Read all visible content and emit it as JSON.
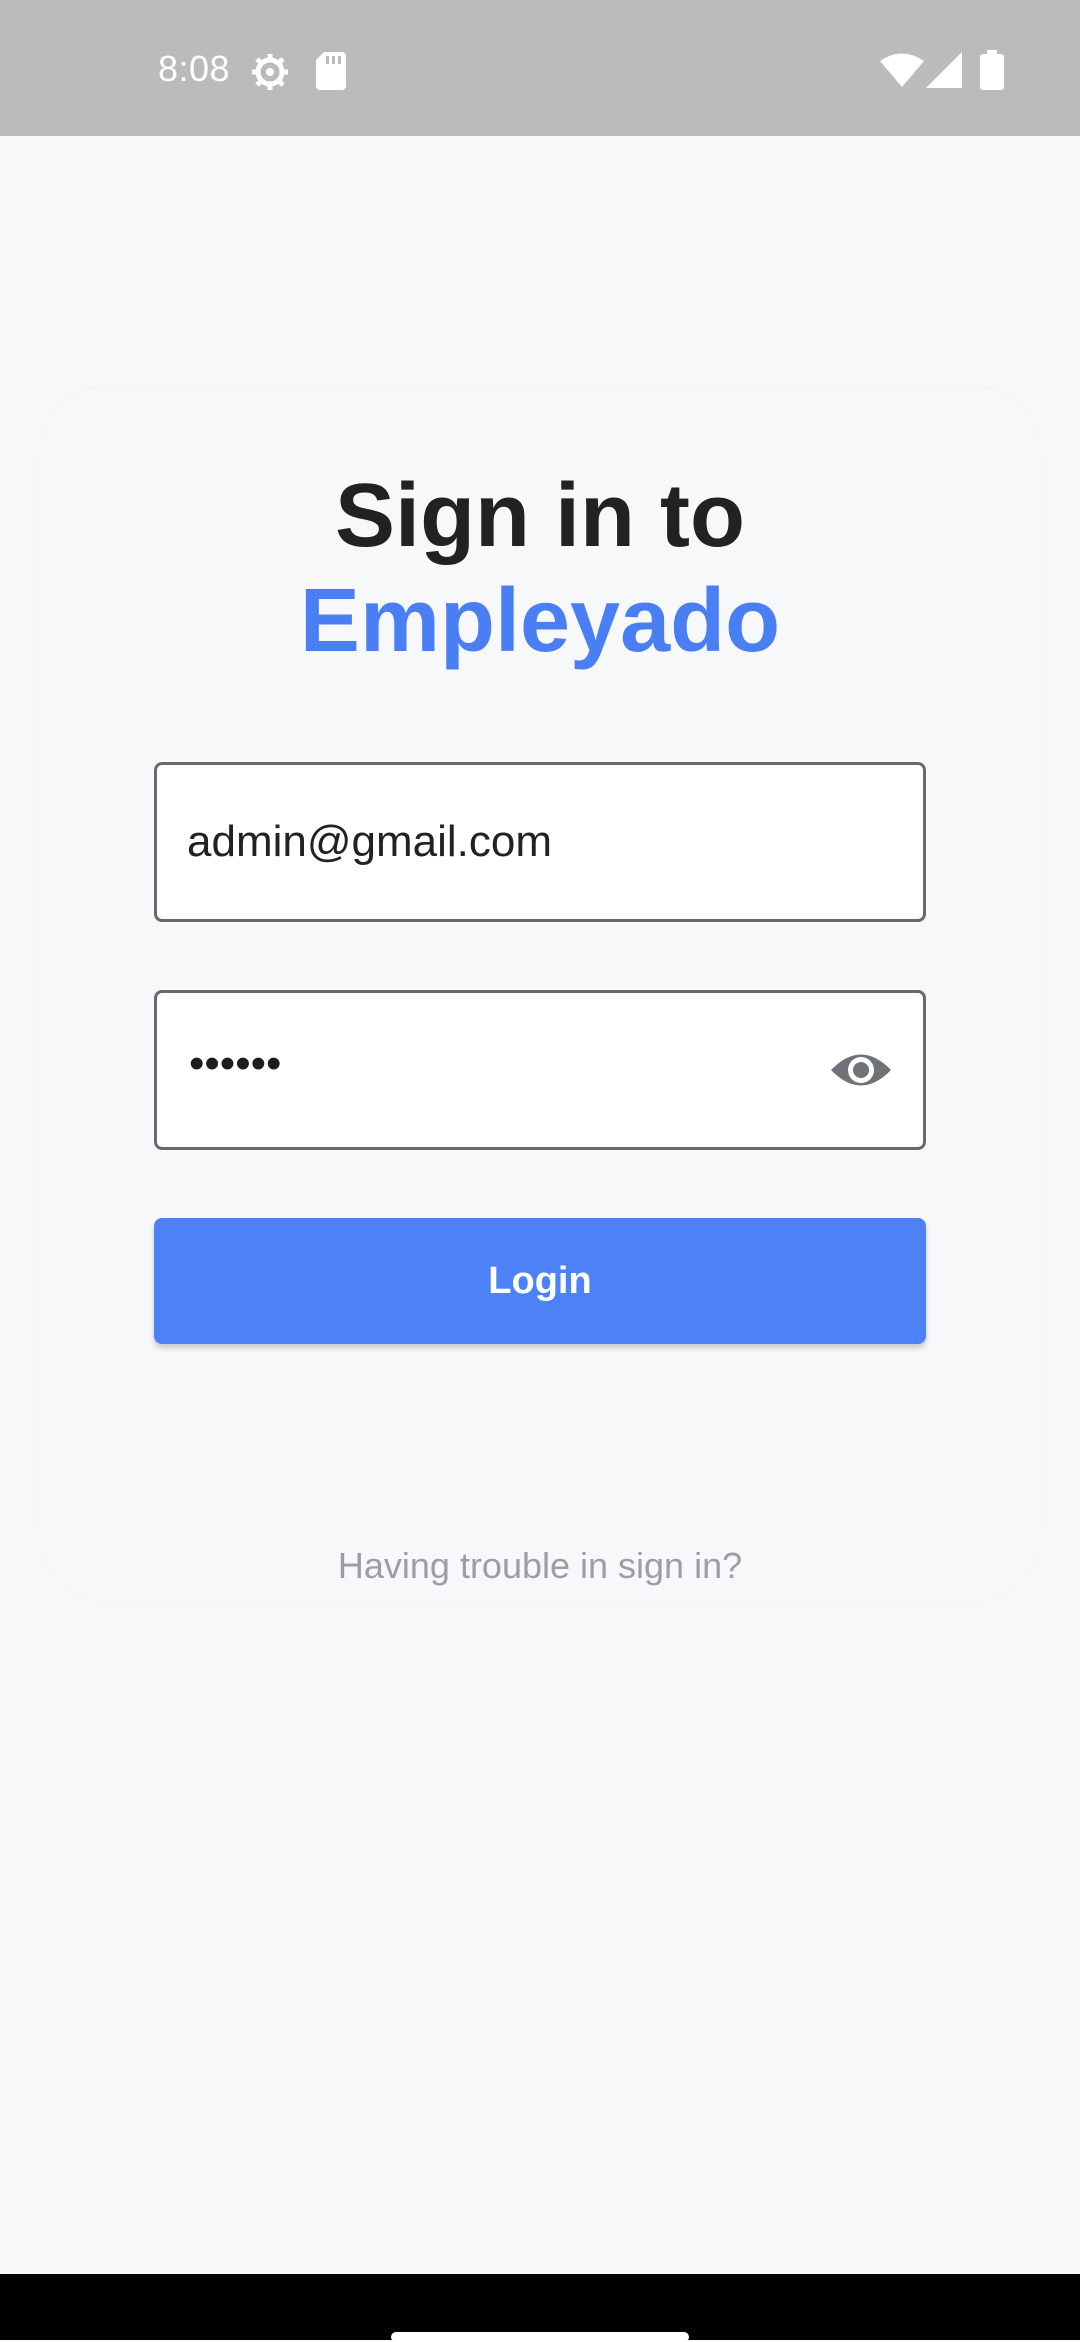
{
  "status_bar": {
    "time": "8:08",
    "icons": [
      "gear-icon",
      "sd-card-icon",
      "wifi-icon",
      "signal-icon",
      "battery-icon"
    ]
  },
  "login": {
    "title_line1": "Sign in to",
    "title_line2": "Empleyado",
    "email_value": "admin@gmail.com",
    "password_value": "••••••",
    "login_label": "Login",
    "trouble_text": "Having trouble in sign in?"
  },
  "colors": {
    "accent": "#4a7ff3",
    "status_bar": "#bbbbbd",
    "background": "#f8f9fb"
  }
}
